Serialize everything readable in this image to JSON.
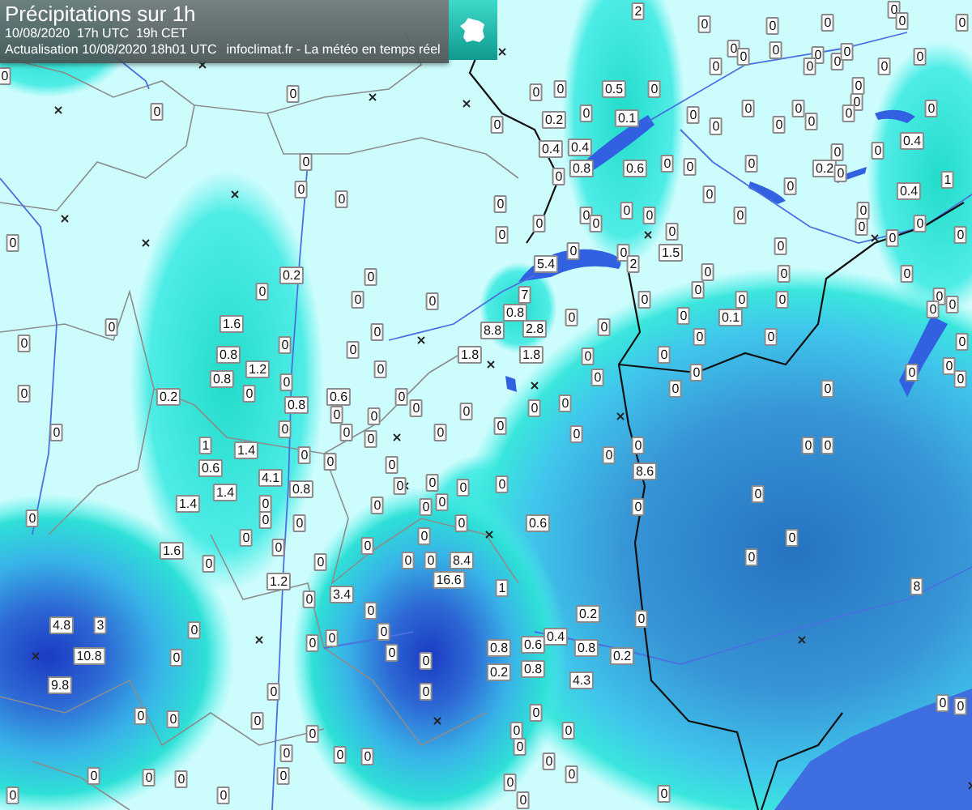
{
  "header": {
    "title": "Précipitations sur 1h",
    "time_line": "10/08/2020  17h UTC  19h CET",
    "update_line": "Actualisation 10/08/2020 18h01 UTC",
    "source_line": "infoclimat.fr - La météo en temps réel"
  },
  "map": {
    "station_values": [
      "0",
      "0",
      "0",
      "0",
      "0",
      "0",
      "0",
      "2",
      "0",
      "0",
      "0",
      "0",
      "0",
      "0",
      "0",
      "0",
      "0",
      "0",
      "0",
      "0",
      "0",
      "0",
      "0",
      "0",
      "0",
      "0",
      "0.5",
      "0",
      "0",
      "0.2",
      "0",
      "0.1",
      "0",
      "0",
      "0",
      "0",
      "0",
      "0",
      "0",
      "0",
      "0",
      "0",
      "0.4",
      "0.4",
      "0.4",
      "0",
      "0.8",
      "0.6",
      "0",
      "0",
      "0",
      "0",
      "0.2",
      "0",
      "0",
      "0",
      "0",
      "1",
      "0.4",
      "0",
      "0",
      "0",
      "0",
      "0",
      "0",
      "0",
      "0",
      "0",
      "0",
      "0",
      "0",
      "0",
      "0",
      "0",
      "0",
      "5.4",
      "1.5",
      "2",
      "0",
      "0.2",
      "0",
      "0",
      "0",
      "0",
      "0",
      "0",
      "1.6",
      "0.8",
      "1.2",
      "0.8",
      "0",
      "0",
      "0",
      "0",
      "0",
      "0",
      "1.8",
      "0",
      "0.2",
      "0.8",
      "0.6",
      "0",
      "0",
      "0",
      "0",
      "0",
      "0",
      "0",
      "0",
      "0",
      "0",
      "1",
      "1.4",
      "0.6",
      "0",
      "0",
      "0",
      "4.1",
      "1.4",
      "0.8",
      "1.4",
      "0",
      "0",
      "0",
      "0",
      "0",
      "0",
      "0",
      "0",
      "0",
      "0",
      "0",
      "0",
      "0",
      "7",
      "0.8",
      "8.8",
      "2.8",
      "1.8",
      "0",
      "0",
      "0",
      "0",
      "0",
      "0",
      "0",
      "0",
      "0",
      "0",
      "0",
      "0",
      "0",
      "0",
      "0",
      "0.1",
      "0",
      "0",
      "0",
      "0",
      "0",
      "0",
      "0",
      "0",
      "0",
      "0",
      "0",
      "0",
      "0",
      "0",
      "0",
      "0",
      "0",
      "0",
      "8.6",
      "0",
      "0",
      "0",
      "0.6",
      "1.6",
      "0",
      "0",
      "0",
      "0",
      "0",
      "0",
      "8.4",
      "16.6",
      "1.2",
      "0",
      "3.4",
      "0",
      "4.8",
      "3",
      "0",
      "0",
      "0",
      "0",
      "10.8",
      "0",
      "0",
      "0",
      "9.8",
      "0",
      "0",
      "0",
      "0",
      "0",
      "0",
      "0",
      "0",
      "0",
      "0",
      "0",
      "0",
      "0",
      "0",
      "0",
      "0",
      "0",
      "1",
      "8",
      "0.2",
      "0",
      "0.8",
      "0.6",
      "0.4",
      "0.8",
      "0.2",
      "0.2",
      "0.8",
      "4.3",
      "0",
      "0",
      "0",
      "0",
      "0",
      "0",
      "0",
      "0",
      "0",
      "0",
      "0"
    ]
  }
}
